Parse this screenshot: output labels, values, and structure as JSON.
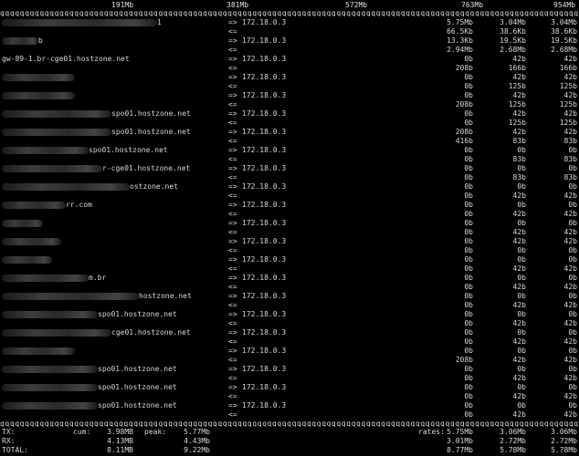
{
  "scale": [
    "191Mb",
    "381Mb",
    "572Mb",
    "763Mb",
    "954Mb"
  ],
  "top_rule": "qqqqqqqqqqqqqqqqqqqqqqqqqqqqqqqqqqqqqqqqqqqqqqqqqqqqqqqqqqqqqqqqqqqqqqqqqqqqqqqqqqqqqqqqqqqqqqqqqqqqqqqqqqqqqqqqqqqqqqqqq",
  "bottom_rule": "qqqqqqqqqqqqqqqqqqqqqqqqqqqqqqqqqqqqqqqqqqqqqqqqqqqqqqqqqqqqqqqqqqqqqqqqqqqqqqqqqqqqqqqqqqqqqqqqqqqqqqqqqqqqqqqqqqqqqqqqq",
  "connections": [
    {
      "host_visible": "1",
      "redacted": true,
      "out": {
        "dir": "=>",
        "dst": "172.18.0.3",
        "r": [
          "5.75Mb",
          "3.04Mb",
          "3.04Mb"
        ]
      },
      "in": {
        "dir": "<=",
        "r": [
          "66.5Kb",
          "38.6Kb",
          "38.6Kb"
        ]
      }
    },
    {
      "host_visible": "b",
      "redacted": true,
      "out": {
        "dir": "=>",
        "dst": "172.18.0.3",
        "r": [
          "13.3Kb",
          "19.5Kb",
          "19.5Kb"
        ]
      },
      "in": {
        "dir": "<=",
        "r": [
          "2.94Mb",
          "2.68Mb",
          "2.68Mb"
        ]
      }
    },
    {
      "host_visible": "gw-89-1.br-cge01.hostzone.net",
      "redacted": false,
      "out": {
        "dir": "=>",
        "dst": "172.18.0.3",
        "r": [
          "0b",
          "42b",
          "42b"
        ]
      },
      "in": {
        "dir": "<=",
        "r": [
          "208b",
          "166b",
          "166b"
        ]
      }
    },
    {
      "host_visible": "",
      "redacted": true,
      "out": {
        "dir": "=>",
        "dst": "172.18.0.3",
        "r": [
          "0b",
          "42b",
          "42b"
        ]
      },
      "in": {
        "dir": "<=",
        "r": [
          "0b",
          "125b",
          "125b"
        ]
      }
    },
    {
      "host_visible": "",
      "redacted": true,
      "out": {
        "dir": "=>",
        "dst": "172.18.0.3",
        "r": [
          "0b",
          "42b",
          "42b"
        ]
      },
      "in": {
        "dir": "<=",
        "r": [
          "208b",
          "125b",
          "125b"
        ]
      }
    },
    {
      "host_visible": "spo01.hostzone.net",
      "redacted": true,
      "out": {
        "dir": "=>",
        "dst": "172.18.0.3",
        "r": [
          "0b",
          "42b",
          "42b"
        ]
      },
      "in": {
        "dir": "<=",
        "r": [
          "0b",
          "125b",
          "125b"
        ]
      }
    },
    {
      "host_visible": "spo01.hostzone.net",
      "redacted": true,
      "out": {
        "dir": "=>",
        "dst": "172.18.0.3",
        "r": [
          "208b",
          "42b",
          "42b"
        ]
      },
      "in": {
        "dir": "<=",
        "r": [
          "416b",
          "83b",
          "83b"
        ]
      }
    },
    {
      "host_visible": "spo01.hostzone.net",
      "redacted": true,
      "out": {
        "dir": "=>",
        "dst": "172.18.0.3",
        "r": [
          "0b",
          "0b",
          "0b"
        ]
      },
      "in": {
        "dir": "<=",
        "r": [
          "0b",
          "83b",
          "83b"
        ]
      }
    },
    {
      "host_visible": "r-cge01.hostzone.net",
      "redacted": true,
      "out": {
        "dir": "=>",
        "dst": "172.18.0.3",
        "r": [
          "0b",
          "0b",
          "0b"
        ]
      },
      "in": {
        "dir": "<=",
        "r": [
          "0b",
          "83b",
          "83b"
        ]
      }
    },
    {
      "host_visible": "ostzone.net",
      "redacted": true,
      "out": {
        "dir": "=>",
        "dst": "172.18.0.3",
        "r": [
          "0b",
          "0b",
          "0b"
        ]
      },
      "in": {
        "dir": "<=",
        "r": [
          "0b",
          "42b",
          "42b"
        ]
      }
    },
    {
      "host_visible": "rr.com",
      "redacted": true,
      "out": {
        "dir": "=>",
        "dst": "172.18.0.3",
        "r": [
          "0b",
          "0b",
          "0b"
        ]
      },
      "in": {
        "dir": "<=",
        "r": [
          "0b",
          "42b",
          "42b"
        ]
      }
    },
    {
      "host_visible": "",
      "redacted": true,
      "out": {
        "dir": "=>",
        "dst": "172.18.0.3",
        "r": [
          "0b",
          "0b",
          "0b"
        ]
      },
      "in": {
        "dir": "<=",
        "r": [
          "0b",
          "42b",
          "42b"
        ]
      }
    },
    {
      "host_visible": "",
      "redacted": true,
      "out": {
        "dir": "=>",
        "dst": "172.18.0.3",
        "r": [
          "0b",
          "42b",
          "42b"
        ]
      },
      "in": {
        "dir": "<=",
        "r": [
          "0b",
          "0b",
          "0b"
        ]
      }
    },
    {
      "host_visible": "",
      "redacted": true,
      "out": {
        "dir": "=>",
        "dst": "172.18.0.3",
        "r": [
          "0b",
          "0b",
          "0b"
        ]
      },
      "in": {
        "dir": "<=",
        "r": [
          "0b",
          "42b",
          "42b"
        ]
      }
    },
    {
      "host_visible": "m.br",
      "redacted": true,
      "out": {
        "dir": "=>",
        "dst": "172.18.0.3",
        "r": [
          "0b",
          "0b",
          "0b"
        ]
      },
      "in": {
        "dir": "<=",
        "r": [
          "0b",
          "42b",
          "42b"
        ]
      }
    },
    {
      "host_visible": "hostzone.net",
      "redacted": true,
      "out": {
        "dir": "=>",
        "dst": "172.18.0.3",
        "r": [
          "0b",
          "0b",
          "0b"
        ]
      },
      "in": {
        "dir": "<=",
        "r": [
          "0b",
          "42b",
          "42b"
        ]
      }
    },
    {
      "host_visible": "spo01.hostzone.net",
      "redacted": true,
      "out": {
        "dir": "=>",
        "dst": "172.18.0.3",
        "r": [
          "0b",
          "0b",
          "0b"
        ]
      },
      "in": {
        "dir": "<=",
        "r": [
          "0b",
          "42b",
          "42b"
        ]
      }
    },
    {
      "host_visible": "cge01.hostzone.net",
      "redacted": true,
      "out": {
        "dir": "=>",
        "dst": "172.18.0.3",
        "r": [
          "0b",
          "0b",
          "0b"
        ]
      },
      "in": {
        "dir": "<=",
        "r": [
          "0b",
          "42b",
          "42b"
        ]
      }
    },
    {
      "host_visible": "",
      "redacted": true,
      "out": {
        "dir": "=>",
        "dst": "172.18.0.3",
        "r": [
          "0b",
          "0b",
          "0b"
        ]
      },
      "in": {
        "dir": "<=",
        "r": [
          "208b",
          "42b",
          "42b"
        ]
      }
    },
    {
      "host_visible": "spo01.hostzone.net",
      "redacted": true,
      "out": {
        "dir": "=>",
        "dst": "172.18.0.3",
        "r": [
          "0b",
          "0b",
          "0b"
        ]
      },
      "in": {
        "dir": "<=",
        "r": [
          "0b",
          "42b",
          "42b"
        ]
      }
    },
    {
      "host_visible": "spo01.hostzone.net",
      "redacted": true,
      "out": {
        "dir": "=>",
        "dst": "172.18.0.3",
        "r": [
          "0b",
          "0b",
          "0b"
        ]
      },
      "in": {
        "dir": "<=",
        "r": [
          "0b",
          "42b",
          "42b"
        ]
      }
    },
    {
      "host_visible": "spo01.hostzone.net",
      "redacted": true,
      "out": {
        "dir": "=>",
        "dst": "172.18.0.3",
        "r": [
          "0b",
          "0b",
          "0b"
        ]
      },
      "in": {
        "dir": "<=",
        "r": [
          "0b",
          "42b",
          "42b"
        ]
      }
    }
  ],
  "totals": {
    "cum_label": "cum:",
    "peak_label": "peak:",
    "rates_label": "rates:",
    "rows": [
      {
        "label": "TX:",
        "cum": "3.98MB",
        "peak": "5.77Mb",
        "rates": [
          "5.75Mb",
          "3.06Mb",
          "3.06Mb"
        ]
      },
      {
        "label": "RX:",
        "cum": "4.13MB",
        "peak": "4.43Mb",
        "rates": [
          "3.01Mb",
          "2.72Mb",
          "2.72Mb"
        ]
      },
      {
        "label": "TOTAL:",
        "cum": "8.11MB",
        "peak": "9.22Mb",
        "rates": [
          "8.77Mb",
          "5.78Mb",
          "5.78Mb"
        ]
      }
    ]
  }
}
